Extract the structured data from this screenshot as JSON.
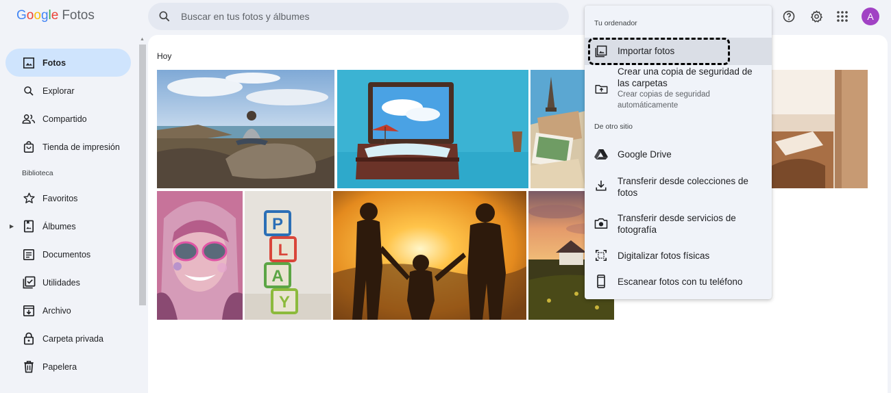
{
  "app": {
    "logo_letters": [
      {
        "ch": "G",
        "color": "#4285f4"
      },
      {
        "ch": "o",
        "color": "#ea4335"
      },
      {
        "ch": "o",
        "color": "#fbbc05"
      },
      {
        "ch": "g",
        "color": "#4285f4"
      },
      {
        "ch": "l",
        "color": "#34a853"
      },
      {
        "ch": "e",
        "color": "#ea4335"
      }
    ],
    "product_name": "Fotos"
  },
  "search": {
    "placeholder": "Buscar en tus fotos y álbumes"
  },
  "header": {
    "avatar_letter": "A"
  },
  "sidebar": {
    "items": [
      {
        "label": "Fotos",
        "icon": "photo-icon",
        "active": true
      },
      {
        "label": "Explorar",
        "icon": "search-icon"
      },
      {
        "label": "Compartido",
        "icon": "people-icon"
      },
      {
        "label": "Tienda de impresión",
        "icon": "shopping-bag-icon"
      }
    ],
    "library_label": "Biblioteca",
    "library_items": [
      {
        "label": "Favoritos",
        "icon": "star-icon"
      },
      {
        "label": "Álbumes",
        "icon": "album-icon"
      },
      {
        "label": "Documentos",
        "icon": "document-icon"
      },
      {
        "label": "Utilidades",
        "icon": "utilities-icon"
      },
      {
        "label": "Archivo",
        "icon": "archive-icon"
      },
      {
        "label": "Carpeta privada",
        "icon": "lock-icon"
      },
      {
        "label": "Papelera",
        "icon": "trash-icon"
      }
    ]
  },
  "main": {
    "date_label": "Hoy"
  },
  "menu": {
    "section_computer": "Tu ordenador",
    "import_label": "Importar fotos",
    "backup_label": "Crear una copia de seguridad de las carpetas",
    "backup_sub": "Crear copias de seguridad automáticamente",
    "section_other": "De otro sitio",
    "drive_label": "Google Drive",
    "transfer_collections_label": "Transferir desde colecciones de fotos",
    "transfer_services_label": "Transferir desde servicios de fotografía",
    "digitize_label": "Digitalizar fotos físicas",
    "scan_label": "Escanear fotos con tu teléfono"
  },
  "colors": {
    "active_nav": "#cfe4fd",
    "avatar": "#a142c4",
    "menu_bg": "#f0f3f9"
  }
}
